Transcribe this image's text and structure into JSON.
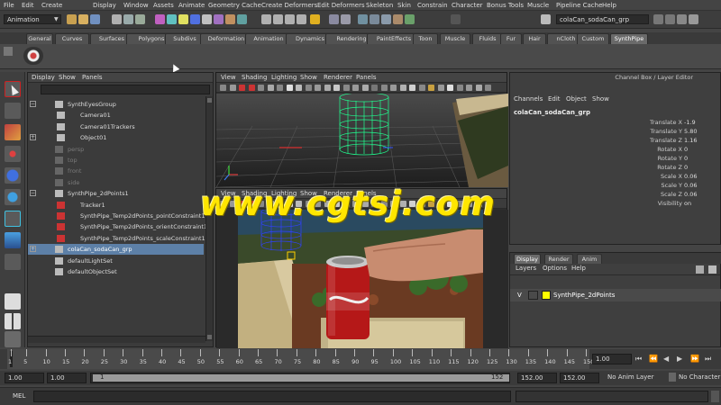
{
  "menubar": [
    "File",
    "Edit",
    "Create",
    "Display",
    "Window",
    "Assets",
    "Animate",
    "Geometry Cache",
    "Create Deformers",
    "Edit Deformers",
    "Skeleton",
    "Skin",
    "Constrain",
    "Character",
    "Bonus Tools",
    "Muscle",
    "Pipeline Cache",
    "Help"
  ],
  "status": {
    "mode": "Animation",
    "selection_field": "colaCan_sodaCan_grp"
  },
  "shelf_tabs": [
    "General",
    "Curves",
    "Surfaces",
    "Polygons",
    "Subdivs",
    "Deformation",
    "Animation",
    "Dynamics",
    "Rendering",
    "PaintEffects",
    "Toon",
    "Muscle",
    "Fluids",
    "Fur",
    "Hair",
    "nCloth",
    "Custom",
    "SynthPipe"
  ],
  "shelf_active": "SynthPipe",
  "outliner": {
    "menu": [
      "Display",
      "Show",
      "Panels"
    ],
    "rows": [
      {
        "label": "SynthEyesGroup",
        "level": 0,
        "dim": false,
        "expander": "−"
      },
      {
        "label": "Camera01",
        "level": 1,
        "dim": false,
        "expander": ""
      },
      {
        "label": "Camera01Trackers",
        "level": 1,
        "dim": false,
        "expander": ""
      },
      {
        "label": "Object01",
        "level": 1,
        "dim": false,
        "expander": "+"
      },
      {
        "label": "persp",
        "level": 0,
        "dim": true,
        "expander": ""
      },
      {
        "label": "top",
        "level": 0,
        "dim": true,
        "expander": ""
      },
      {
        "label": "front",
        "level": 0,
        "dim": true,
        "expander": ""
      },
      {
        "label": "side",
        "level": 0,
        "dim": true,
        "expander": ""
      },
      {
        "label": "SynthPipe_2dPoints1",
        "level": 0,
        "dim": false,
        "expander": "−"
      },
      {
        "label": "Tracker1",
        "level": 1,
        "dim": false,
        "expander": ""
      },
      {
        "label": "SynthPipe_Temp2dPoints_pointConstraint1",
        "level": 1,
        "dim": false,
        "expander": ""
      },
      {
        "label": "SynthPipe_Temp2dPoints_orientConstraint1",
        "level": 1,
        "dim": false,
        "expander": ""
      },
      {
        "label": "SynthPipe_Temp2dPoints_scaleConstraint1",
        "level": 1,
        "dim": false,
        "expander": ""
      },
      {
        "label": "colaCan_sodaCan_grp",
        "level": 0,
        "dim": false,
        "expander": "+",
        "selected": true
      },
      {
        "label": "defaultLightSet",
        "level": 0,
        "dim": false,
        "expander": ""
      },
      {
        "label": "defaultObjectSet",
        "level": 0,
        "dim": false,
        "expander": ""
      }
    ]
  },
  "viewport_menu": [
    "View",
    "Shading",
    "Lighting",
    "Show",
    "Renderer",
    "Panels"
  ],
  "channel_box": {
    "title": "Channel Box / Layer Editor",
    "menu": [
      "Channels",
      "Edit",
      "Object",
      "Show"
    ],
    "object": "colaCan_sodaCan_grp",
    "attrs": [
      {
        "name": "Translate X",
        "value": "-1.9"
      },
      {
        "name": "Translate Y",
        "value": "5.80"
      },
      {
        "name": "Translate Z",
        "value": "1.16"
      },
      {
        "name": "Rotate X",
        "value": "0"
      },
      {
        "name": "Rotate Y",
        "value": "0"
      },
      {
        "name": "Rotate Z",
        "value": "0"
      },
      {
        "name": "Scale X",
        "value": "0.06"
      },
      {
        "name": "Scale Y",
        "value": "0.06"
      },
      {
        "name": "Scale Z",
        "value": "0.06"
      },
      {
        "name": "Visibility",
        "value": "on"
      }
    ]
  },
  "layer_editor": {
    "tabs": [
      "Display",
      "Render",
      "Anim"
    ],
    "active_tab": "Display",
    "menu": [
      "Layers",
      "Options",
      "Help"
    ],
    "layer": {
      "visible": "V",
      "name": "SynthPipe_2dPoints",
      "color": "#ffff00"
    }
  },
  "timeline": {
    "ticks": [
      "1",
      "5",
      "10",
      "15",
      "20",
      "25",
      "30",
      "35",
      "40",
      "45",
      "50",
      "55",
      "60",
      "65",
      "70",
      "75",
      "80",
      "85",
      "90",
      "95",
      "100",
      "105",
      "110",
      "115",
      "120",
      "125",
      "130",
      "135",
      "140",
      "145",
      "150"
    ],
    "current_frame": "1.00"
  },
  "range": {
    "start": "1.00",
    "start_inner": "1.00",
    "range_start_label": "1",
    "range_end_label": "152",
    "end_inner": "152.00",
    "end": "152.00",
    "anim_layer": "No Anim Layer",
    "character_set": "No Character Se"
  },
  "cmdline": {
    "label": "MEL"
  },
  "watermark": "www.cgtsj.com",
  "colors": {
    "selection": "#5d80a7",
    "can_wire": "#20ff90",
    "wire_blue": "#3040ff",
    "accent_yellow": "#ffe600"
  }
}
